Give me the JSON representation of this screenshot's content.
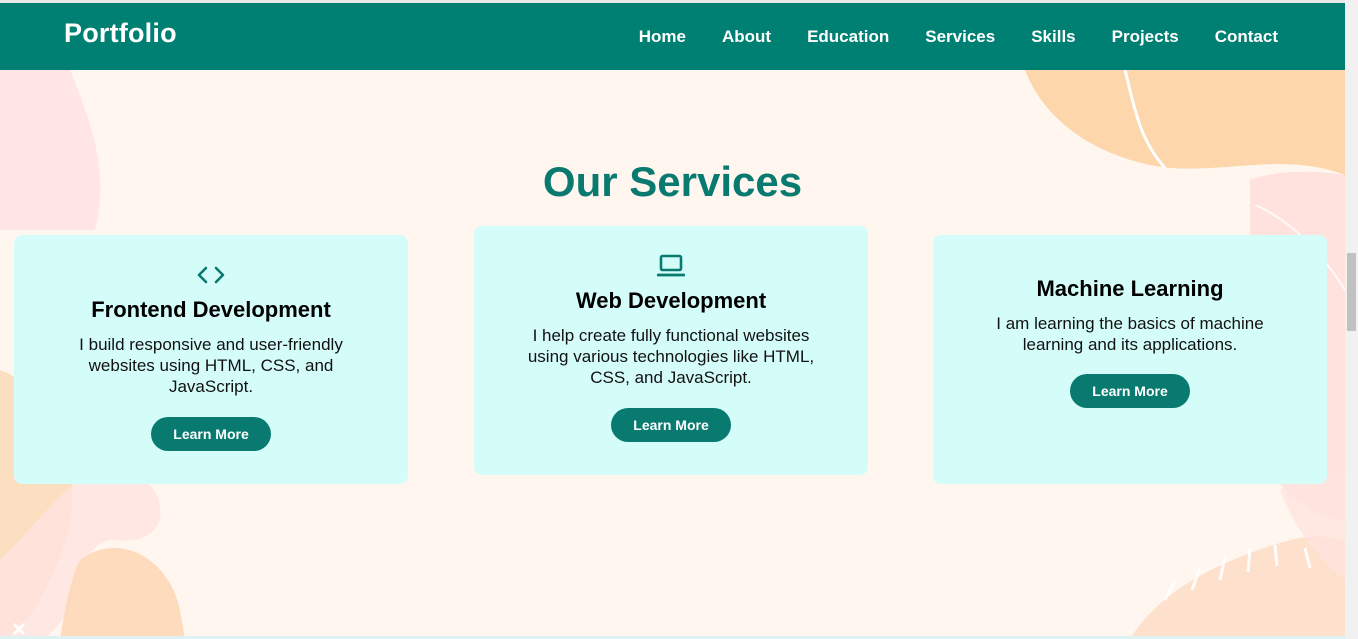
{
  "navbar": {
    "brand": "Portfolio",
    "links": [
      "Home",
      "About",
      "Education",
      "Services",
      "Skills",
      "Projects",
      "Contact"
    ]
  },
  "section": {
    "title": "Our Services"
  },
  "cards": [
    {
      "icon": "code-icon",
      "title": "Frontend Development",
      "description": "I build responsive and user-friendly websites using HTML, CSS, and JavaScript.",
      "button": "Learn More"
    },
    {
      "icon": "laptop-icon",
      "title": "Web Development",
      "description": "I help create fully functional websites using various technologies like HTML, CSS, and JavaScript.",
      "button": "Learn More"
    },
    {
      "icon": "",
      "title": "Machine Learning",
      "description": "I am learning the basics of machine learning and its applications.",
      "button": "Learn More"
    }
  ],
  "colors": {
    "primary": "#008072",
    "title": "#087a6f",
    "card_bg": "#d4fdfa",
    "page_bg": "#fff6f0",
    "blob_orange": "#fdd4a8",
    "blob_pink": "#ffe3e0"
  }
}
